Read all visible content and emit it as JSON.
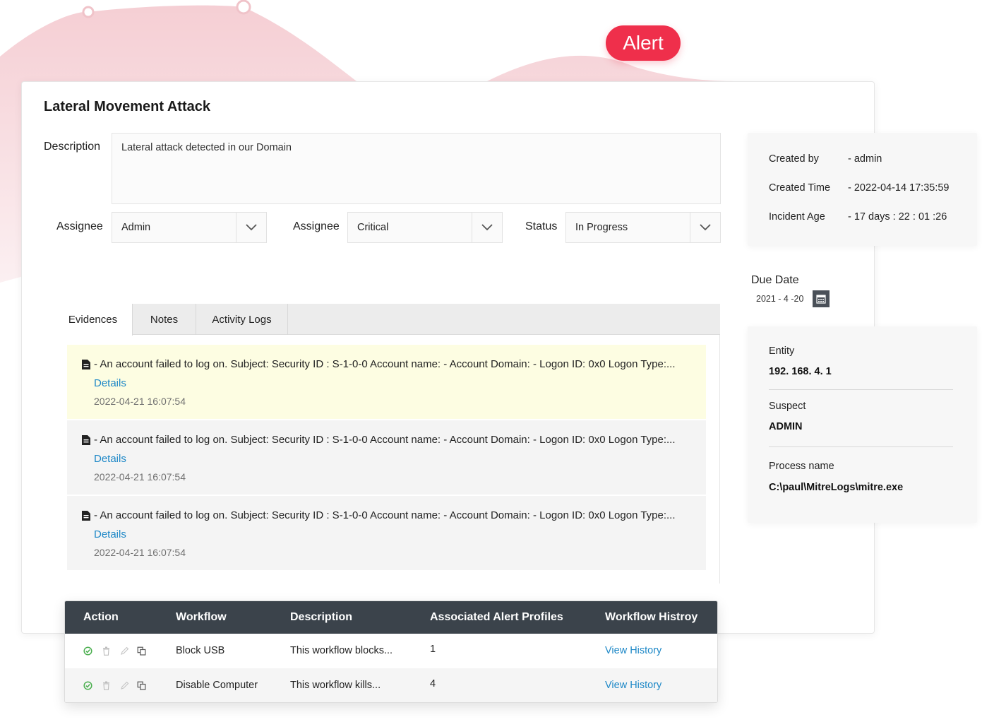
{
  "alert_badge": "Alert",
  "incident": {
    "title": "Lateral Movement Attack",
    "description_label": "Description",
    "description": "Lateral attack detected in our Domain"
  },
  "fields": {
    "assignee_label": "Assignee",
    "assignee_value": "Admin",
    "severity_label": "Assignee",
    "severity_value": "Critical",
    "status_label": "Status",
    "status_value": "In Progress"
  },
  "tabs": [
    {
      "label": "Evidences",
      "active": true
    },
    {
      "label": "Notes",
      "active": false
    },
    {
      "label": "Activity Logs",
      "active": false
    }
  ],
  "evidences": [
    {
      "text": "- An account failed to log on. Subject: Security ID : S-1-0-0 Account name: - Account Domain: - Logon ID: 0x0 Logon Type:...",
      "link": "Details",
      "time": "2022-04-21 16:07:54",
      "highlight_color": "#fdfde2"
    },
    {
      "text": "- An account failed to log on. Subject: Security ID : S-1-0-0 Account name: - Account Domain: - Logon ID: 0x0 Logon Type:...",
      "link": "Details",
      "time": "2022-04-21 16:07:54",
      "highlight_color": "#f4f4f4"
    },
    {
      "text": "- An account failed to log on. Subject: Security ID : S-1-0-0 Account name: - Account Domain: - Logon ID: 0x0 Logon Type:...",
      "link": "Details",
      "time": "2022-04-21 16:07:54",
      "highlight_color": "#f4f4f4"
    }
  ],
  "meta": {
    "created_by_label": "Created by",
    "created_by": "- admin",
    "created_time_label": "Created Time",
    "created_time": "- 2022-04-14 17:35:59",
    "incident_age_label": "Incident Age",
    "incident_age": "- 17 days : 22 : 01 :26"
  },
  "due": {
    "label": "Due Date",
    "value": "2021 - 4 -20",
    "icon": "calendar-icon"
  },
  "entity": {
    "entity_label": "Entity",
    "entity_value": "192. 168. 4. 1",
    "suspect_label": "Suspect",
    "suspect_value": "ADMIN",
    "process_label": "Process name",
    "process_value": "C:\\paul\\MitreLogs\\mitre.exe"
  },
  "workflow_table": {
    "columns": [
      "Action",
      "Workflow",
      "Description",
      "Associated Alert Profiles",
      "Workflow Histroy"
    ],
    "action_icons": [
      "check-circle-icon",
      "trash-icon",
      "pencil-icon",
      "copy-icon"
    ],
    "rows": [
      {
        "workflow": "Block USB",
        "description": "This workflow blocks...",
        "profiles": "1",
        "history": "View History"
      },
      {
        "workflow": "Disable Computer",
        "description": "This workflow kills...",
        "profiles": "4",
        "history": "View History"
      }
    ]
  },
  "colors": {
    "alert": "#ef2f4b",
    "link": "#1e88c7",
    "table_header": "#3b434b",
    "success_icon": "#4caf50"
  }
}
